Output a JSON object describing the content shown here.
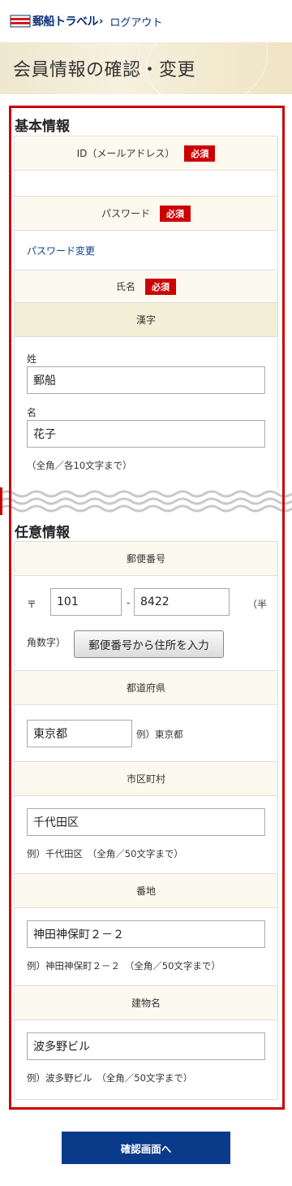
{
  "header": {
    "logo_text": "郵船トラベル",
    "logout": "ログアウト"
  },
  "page_title": "会員情報の確認・変更",
  "basic": {
    "title": "基本情報",
    "id_label": "ID（メールアドレス）",
    "required": "必須",
    "password_label": "パスワード",
    "password_link": "パスワード変更",
    "name_label": "氏名",
    "kanji_label": "漢字",
    "sei_label": "姓",
    "sei_value": "郵船",
    "mei_label": "名",
    "mei_value": "花子",
    "name_note": "（全角／各10文字まで）"
  },
  "optional": {
    "title": "任意情報",
    "zip_label": "郵便番号",
    "zip_mark": "〒",
    "zip1": "101",
    "zip_sep": "-",
    "zip2": "8422",
    "zip_note_a": "（半",
    "zip_note_b": "角数字）",
    "zip_button": "郵便番号から住所を入力",
    "pref_label": "都道府県",
    "pref_value": "東京都",
    "pref_example": "例）東京都",
    "city_label": "市区町村",
    "city_value": "千代田区",
    "city_note": "例）千代田区　（全角／50文字まで）",
    "addr_label": "番地",
    "addr_value": "神田神保町２－２",
    "addr_note": "例）神田神保町２－２　（全角／50文字まで）",
    "bldg_label": "建物名",
    "bldg_value": "波多野ビル",
    "bldg_note": "例）波多野ビル　（全角／50文字まで）"
  },
  "submit": "確認画面へ"
}
